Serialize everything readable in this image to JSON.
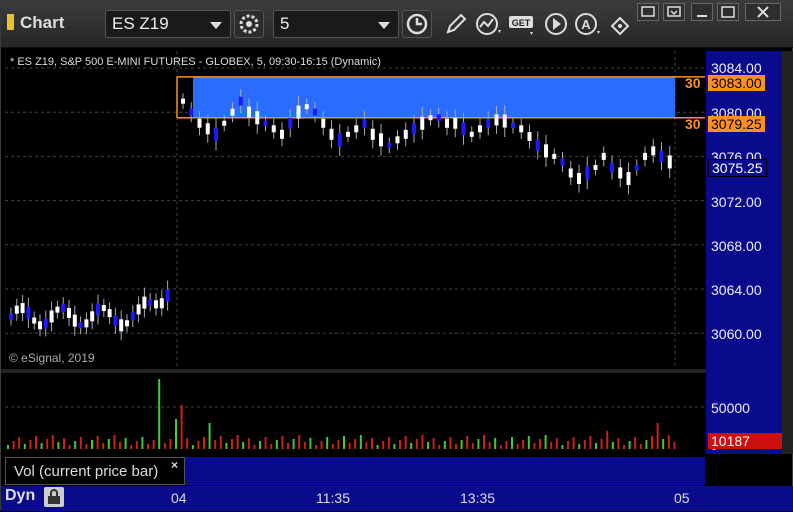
{
  "window": {
    "title": "Chart"
  },
  "toolbar": {
    "symbol": "ES Z19",
    "interval": "5",
    "get_label": "GET"
  },
  "chart": {
    "title": "* ES Z19, S&P 500 E-MINI FUTURES - GLOBEX, 5, 09:30-16:15 (Dynamic)",
    "copyright": "© eSignal, 2019",
    "price_ticks": [
      "3084.00",
      "3080.00",
      "3076.00",
      "3072.00",
      "3068.00",
      "3064.00",
      "3060.00"
    ],
    "level_upper": {
      "marker": "30",
      "price": "3083.00"
    },
    "level_lower": {
      "marker": "30",
      "price": "3079.25"
    },
    "last_price": "3075.25",
    "volume_tick": "50000",
    "volume_zero": "0",
    "volume_value": "10187",
    "volume_label": "Vol (current price bar)",
    "close_mark": "×",
    "time_ticks": [
      "04",
      "11:35",
      "13:35",
      "05"
    ],
    "dyn_label": "Dyn",
    "colors": {
      "up": "#ffffff",
      "down": "#1a1aff",
      "zone": "#2a6cff",
      "level": "#ff9020",
      "vol_up": "#3ccc3c",
      "vol_down": "#cc2020"
    }
  },
  "icons": [
    "chart-bar-icon",
    "settings-gear-icon",
    "clock-icon",
    "pencil-icon",
    "indicator-icon",
    "get-icon",
    "play-icon",
    "alert-icon",
    "diamond-tool-icon",
    "minimize-icon",
    "restore-icon",
    "maximize-icon",
    "close-icon",
    "lock-icon"
  ]
}
